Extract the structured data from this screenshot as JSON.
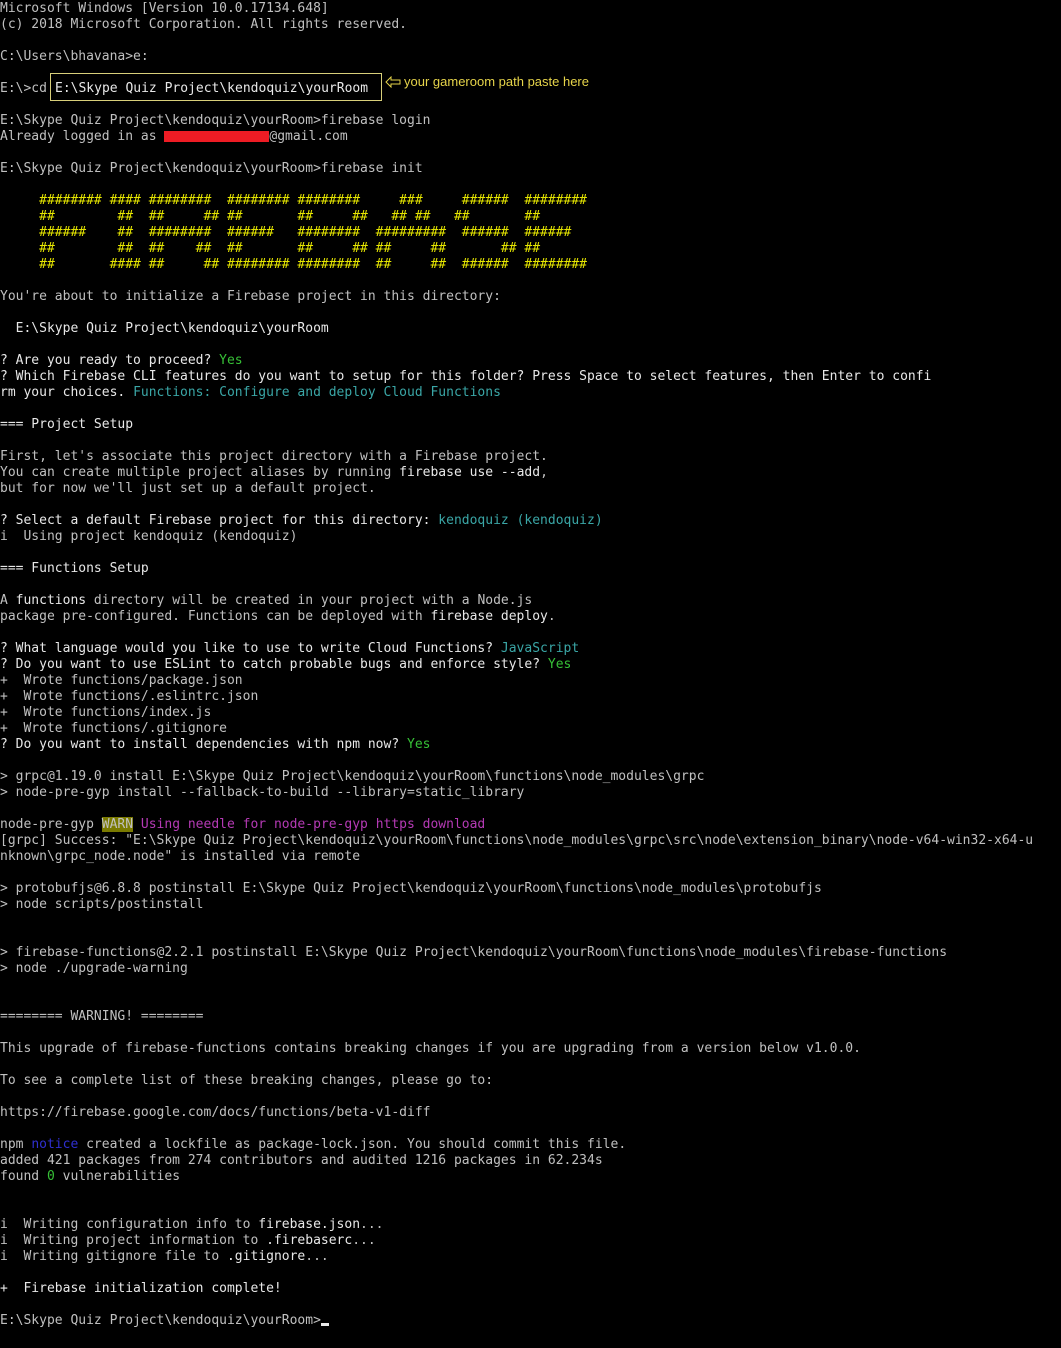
{
  "terminal": {
    "header": [
      "Microsoft Windows [Version 10.0.17134.648]",
      "(c) 2018 Microsoft Corporation. All rights reserved."
    ],
    "prompt_user": "C:\\Users\\bhavana>e:",
    "cd_prompt": "E:\\>cd",
    "cd_path": "E:\\Skype Quiz Project\\kendoquiz\\yourRoom",
    "annotation": "your gameroom path paste here",
    "login_cmd": "E:\\Skype Quiz Project\\kendoquiz\\yourRoom>firebase login",
    "logged_in_prefix": "Already logged in as ",
    "logged_in_suffix": "@gmail.com",
    "init_cmd": "E:\\Skype Quiz Project\\kendoquiz\\yourRoom>firebase init",
    "banner": [
      "     ######## #### ########  ######## ########     ###     ######  ########",
      "     ##        ##  ##     ## ##       ##     ##   ## ##   ##       ##",
      "     ######    ##  ########  ######   ########  #########  ######  ######",
      "     ##        ##  ##    ##  ##       ##     ## ##     ##       ## ##",
      "     ##       #### ##     ## ######## ########  ##     ##  ######  ########"
    ],
    "about_to_init": "You're about to initialize a Firebase project in this directory:",
    "init_dir": "  E:\\Skype Quiz Project\\kendoquiz\\yourRoom",
    "q_ready": "? Are you ready to proceed? ",
    "a_ready": "Yes",
    "q_features_1": "? Which Firebase CLI features do you want to setup for this folder? Press Space to select features, then Enter to confi",
    "q_features_2": "rm your choices. ",
    "a_features": "Functions: Configure and deploy Cloud Functions",
    "project_setup": "=== Project Setup",
    "assoc_1": "First, let's associate this project directory with a Firebase project.",
    "assoc_2a": "You can create multiple project aliases by running ",
    "assoc_2b": "firebase use --add",
    "assoc_2c": ",",
    "assoc_3": "but for now we'll just set up a default project.",
    "q_project": "? Select a default Firebase project for this directory: ",
    "a_project": "kendoquiz (kendoquiz)",
    "using_project": "i  Using project kendoquiz (kendoquiz)",
    "functions_setup": "=== Functions Setup",
    "fn_desc_1a": "A ",
    "fn_desc_1b": "functions",
    "fn_desc_1c": " directory will be created in your project with a Node.js",
    "fn_desc_2a": "package pre-configured. Functions can be deployed with ",
    "fn_desc_2b": "firebase deploy",
    "fn_desc_2c": ".",
    "q_language": "? What language would you like to use to write Cloud Functions? ",
    "a_language": "JavaScript",
    "q_eslint": "? Do you want to use ESLint to catch probable bugs and enforce style? ",
    "a_eslint": "Yes",
    "wrote": [
      "+  Wrote functions/package.json",
      "+  Wrote functions/.eslintrc.json",
      "+  Wrote functions/index.js",
      "+  Wrote functions/.gitignore"
    ],
    "q_install": "? Do you want to install dependencies with npm now? ",
    "a_install": "Yes",
    "grpc_1": "> grpc@1.19.0 install E:\\Skype Quiz Project\\kendoquiz\\yourRoom\\functions\\node_modules\\grpc",
    "grpc_2": "> node-pre-gyp install --fallback-to-build --library=static_library",
    "npg_prefix": "node-pre-gyp ",
    "npg_warn": "WARN",
    "npg_msg": " Using needle for node-pre-gyp https download",
    "grpc_success_1": "[grpc] Success: \"E:\\Skype Quiz Project\\kendoquiz\\yourRoom\\functions\\node_modules\\grpc\\src\\node\\extension_binary\\node-v64-win32-x64-u",
    "grpc_success_2": "nknown\\grpc_node.node\" is installed via remote",
    "protobuf_1": "> protobufjs@6.8.8 postinstall E:\\Skype Quiz Project\\kendoquiz\\yourRoom\\functions\\node_modules\\protobufjs",
    "protobuf_2": "> node scripts/postinstall",
    "ff_1": "> firebase-functions@2.2.1 postinstall E:\\Skype Quiz Project\\kendoquiz\\yourRoom\\functions\\node_modules\\firebase-functions",
    "ff_2": "> node ./upgrade-warning",
    "warning_banner": "======== WARNING! ========",
    "upgrade_msg": "This upgrade of firebase-functions contains breaking changes if you are upgrading from a version below v1.0.0.",
    "see_list": "To see a complete list of these breaking changes, please go to:",
    "url": "https://firebase.google.com/docs/functions/beta-v1-diff",
    "npm_prefix": "npm ",
    "npm_notice": "notice",
    "npm_msg": " created a lockfile as package-lock.json. You should commit this file.",
    "added": "added 421 packages from 274 contributors and audited 1216 packages in 62.234s",
    "found_prefix": "found ",
    "found_count": "0",
    "found_suffix": " vulnerabilities",
    "writing_1a": "i  Writing configuration info to ",
    "writing_1b": "firebase.json",
    "writing_1c": "...",
    "writing_2a": "i  Writing project information to ",
    "writing_2b": ".firebaserc",
    "writing_2c": "...",
    "writing_3a": "i  Writing gitignore file to ",
    "writing_3b": ".gitignore",
    "writing_3c": "...",
    "complete": "+  Firebase initialization complete!",
    "final_prompt": "E:\\Skype Quiz Project\\kendoquiz\\yourRoom>"
  }
}
